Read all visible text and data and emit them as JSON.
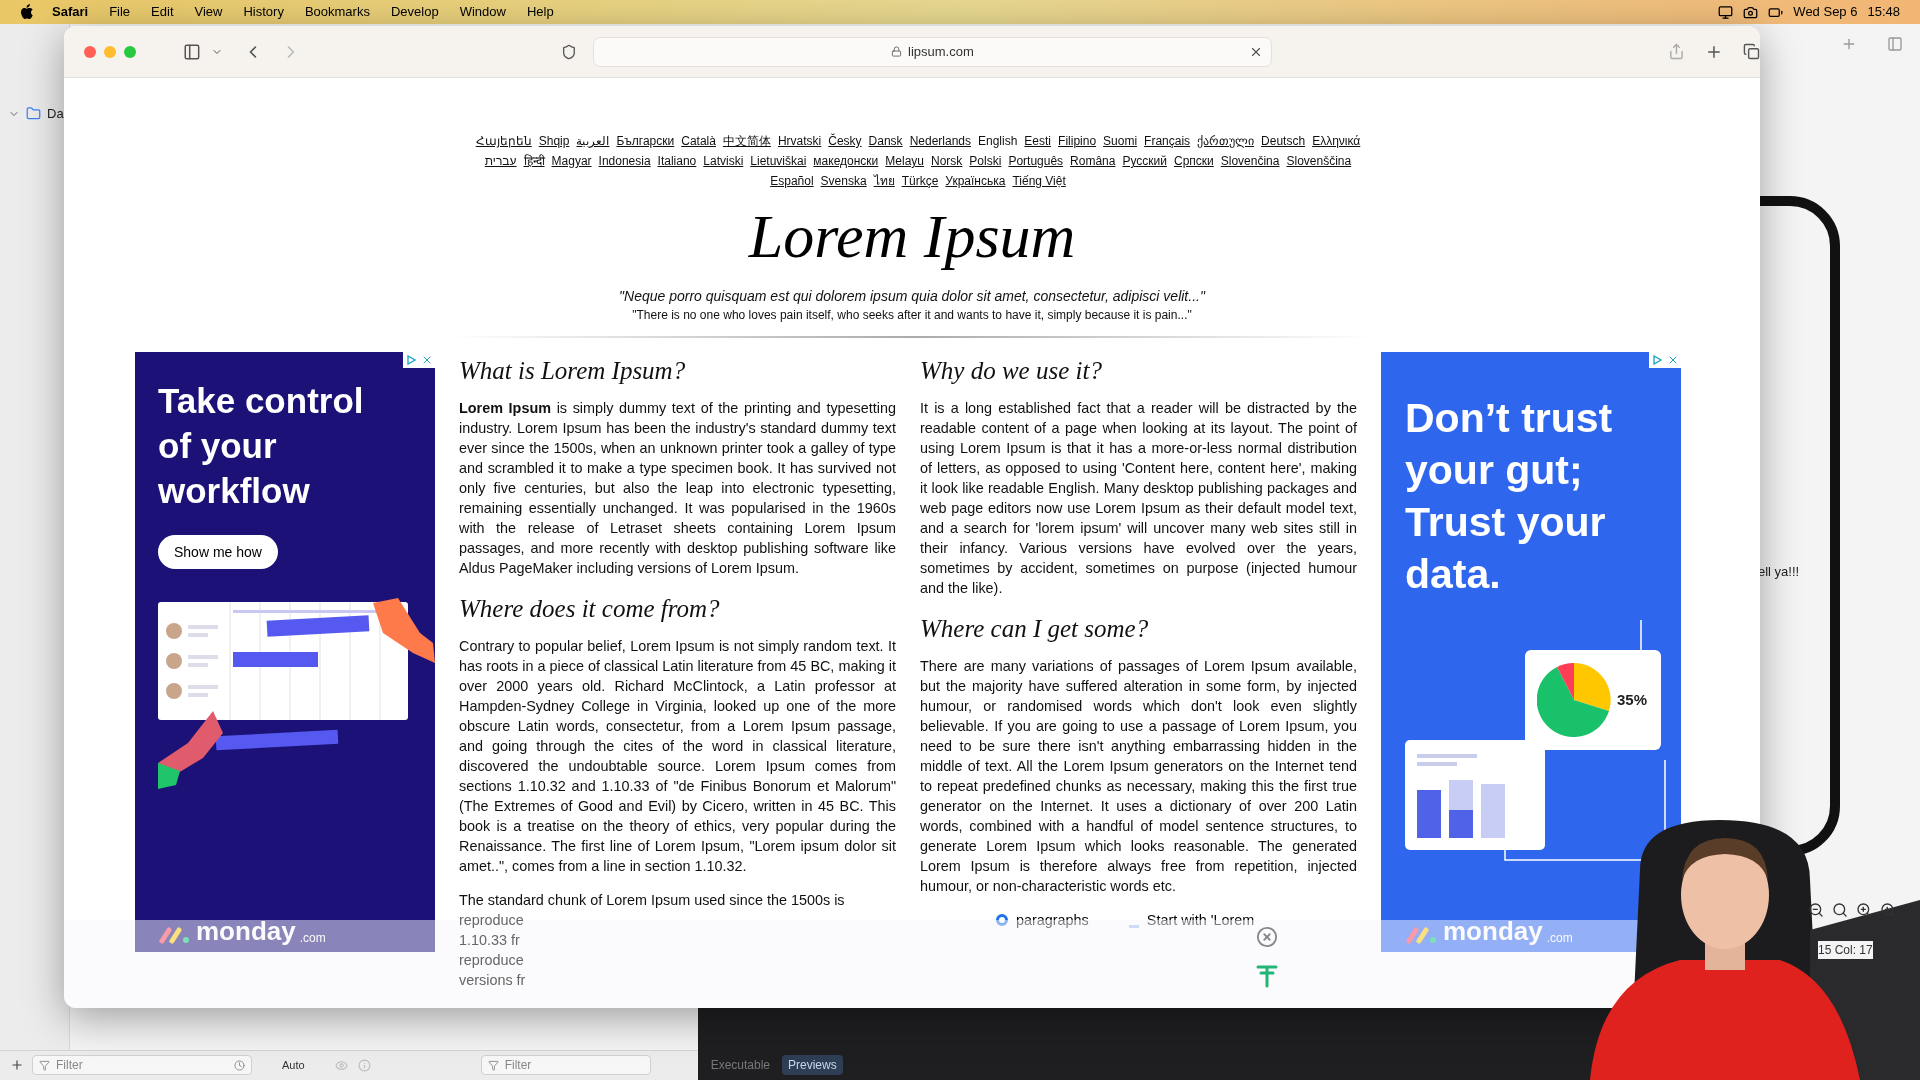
{
  "menu_bar": {
    "app": "Safari",
    "items": [
      "File",
      "Edit",
      "View",
      "History",
      "Bookmarks",
      "Develop",
      "Window",
      "Help"
    ],
    "date": "Wed Sep 6",
    "time": "15:48"
  },
  "browser": {
    "url": "lipsum.com"
  },
  "page": {
    "language_rows": [
      {
        "items": [
          {
            "label": "Հայերեն",
            "selected": false
          },
          {
            "label": "Shqip",
            "selected": false
          },
          {
            "label": "العربية",
            "selected": false
          },
          {
            "label": "Български",
            "selected": false
          },
          {
            "label": "Català",
            "selected": false
          },
          {
            "label": "中文简体",
            "selected": false
          },
          {
            "label": "Hrvatski",
            "selected": false
          },
          {
            "label": "Česky",
            "selected": false
          },
          {
            "label": "Dansk",
            "selected": false
          },
          {
            "label": "Nederlands",
            "selected": false
          },
          {
            "label": "English",
            "selected": true
          },
          {
            "label": "Eesti",
            "selected": false
          },
          {
            "label": "Filipino",
            "selected": false
          },
          {
            "label": "Suomi",
            "selected": false
          },
          {
            "label": "Français",
            "selected": false
          },
          {
            "label": "ქართული",
            "selected": false
          },
          {
            "label": "Deutsch",
            "selected": false
          },
          {
            "label": "Ελληνικά",
            "selected": false
          }
        ]
      },
      {
        "items": [
          {
            "label": "עברית",
            "selected": false
          },
          {
            "label": "हिन्दी",
            "selected": false
          },
          {
            "label": "Magyar",
            "selected": false
          },
          {
            "label": "Indonesia",
            "selected": false
          },
          {
            "label": "Italiano",
            "selected": false
          },
          {
            "label": "Latviski",
            "selected": false
          },
          {
            "label": "Lietuviškai",
            "selected": false
          },
          {
            "label": "македонски",
            "selected": false
          },
          {
            "label": "Melayu",
            "selected": false
          },
          {
            "label": "Norsk",
            "selected": false
          },
          {
            "label": "Polski",
            "selected": false
          },
          {
            "label": "Português",
            "selected": false
          },
          {
            "label": "Româna",
            "selected": false
          },
          {
            "label": "Pусский",
            "selected": false
          },
          {
            "label": "Српски",
            "selected": false
          },
          {
            "label": "Slovenčina",
            "selected": false
          },
          {
            "label": "Slovenščina",
            "selected": false
          }
        ]
      },
      {
        "items": [
          {
            "label": "Español",
            "selected": false
          },
          {
            "label": "Svenska",
            "selected": false
          },
          {
            "label": "ไทย",
            "selected": false
          },
          {
            "label": "Türkçe",
            "selected": false
          },
          {
            "label": "Українська",
            "selected": false
          },
          {
            "label": "Tiếng Việt",
            "selected": false
          }
        ]
      }
    ],
    "title": "Lorem Ipsum",
    "quote_latin": "\"Neque porro quisquam est qui dolorem ipsum quia dolor sit amet, consectetur, adipisci velit...\"",
    "quote_english": "\"There is no one who loves pain itself, who seeks after it and wants to have it, simply because it is pain...\"",
    "columns": [
      {
        "sections": [
          {
            "heading": "What is Lorem Ipsum?",
            "body": "**Lorem Ipsum** is simply dummy text of the printing and typesetting industry. Lorem Ipsum has been the industry's standard dummy text ever since the 1500s, when an unknown printer took a galley of type and scrambled it to make a type specimen book. It has survived not only five centuries, but also the leap into electronic typesetting, remaining essentially unchanged. It was popularised in the 1960s with the release of Letraset sheets containing Lorem Ipsum passages, and more recently with desktop publishing software like Aldus PageMaker including versions of Lorem Ipsum."
          },
          {
            "heading": "Where does it come from?",
            "body": "Contrary to popular belief, Lorem Ipsum is not simply random text. It has roots in a piece of classical Latin literature from 45 BC, making it over 2000 years old. Richard McClintock, a Latin professor at Hampden-Sydney College in Virginia, looked up one of the more obscure Latin words, consectetur, from a Lorem Ipsum passage, and going through the cites of the word in classical literature, discovered the undoubtable source. Lorem Ipsum comes from sections 1.10.32 and 1.10.33 of \"de Finibus Bonorum et Malorum\" (The Extremes of Good and Evil) by Cicero, written in 45 BC. This book is a treatise on the theory of ethics, very popular during the Renaissance. The first line of Lorem Ipsum, \"Lorem ipsum dolor sit amet..\", comes from a line in section 1.10.32."
          }
        ],
        "tail": "The standard chunk of Lorem Ipsum used since the 1500s is",
        "faded_lines": [
          "reproduce",
          "1.10.33 fr",
          "reproduce",
          "versions fr"
        ]
      },
      {
        "sections": [
          {
            "heading": "Why do we use it?",
            "body": "It is a long established fact that a reader will be distracted by the readable content of a page when looking at its layout. The point of using Lorem Ipsum is that it has a more-or-less normal distribution of letters, as opposed to using 'Content here, content here', making it look like readable English. Many desktop publishing packages and web page editors now use Lorem Ipsum as their default model text, and a search for 'lorem ipsum' will uncover many web sites still in their infancy. Various versions have evolved over the years, sometimes by accident, sometimes on purpose (injected humour and the like)."
          },
          {
            "heading": "Where can I get some?",
            "body": "There are many variations of passages of Lorem Ipsum available, but the majority have suffered alteration in some form, by injected humour, or randomised words which don't look even slightly believable. If you are going to use a passage of Lorem Ipsum, you need to be sure there isn't anything embarrassing hidden in the middle of text. All the Lorem Ipsum generators on the Internet tend to repeat predefined chunks as necessary, making this the first true generator on the Internet. It uses a dictionary of over 200 Latin words, combined with a handful of model sentence structures, to generate Lorem Ipsum which looks reasonable. The generated Lorem Ipsum is therefore always free from repetition, injected humour, or non-characteristic words etc."
          }
        ],
        "options": [
          {
            "kind": "radio",
            "label": "paragraphs",
            "selected": true
          },
          {
            "kind": "checkbox",
            "label": "Start with 'Lorem",
            "selected": false
          }
        ]
      }
    ],
    "left_ad": {
      "headline": "Take control of your workflow",
      "button": "Show me how",
      "brand": "monday",
      "brand_suffix": ".com"
    },
    "right_ad": {
      "headline": "Don’t trust your gut; Trust your data.",
      "percent": "35%",
      "brand": "monday",
      "brand_suffix": ".com"
    }
  },
  "xcode": {
    "sidebar_item": "Da",
    "preview_text": "ell ya!!!",
    "cursor": "15 Col: 17",
    "filter_placeholder": "Filter",
    "scheme": "Auto",
    "filter2_placeholder": "Filter",
    "tabs": [
      {
        "label": "Executable",
        "selected": false
      },
      {
        "label": "Previews",
        "selected": true
      }
    ]
  }
}
